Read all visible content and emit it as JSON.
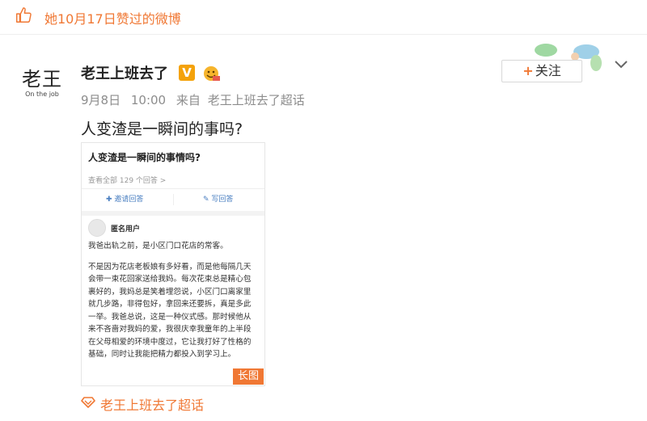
{
  "activity": {
    "text": "她10月17日赞过的微博"
  },
  "author": {
    "avatar_title": "老王",
    "avatar_subtitle": "On the job",
    "name": "老王上班去了",
    "verified_label": "V"
  },
  "post": {
    "date": "9月8日",
    "time": "10:00",
    "source_prefix": "来自",
    "source": "老王上班去了超话",
    "text": "人变渣是一瞬间的事吗?"
  },
  "follow_button": {
    "label": "关注"
  },
  "card": {
    "question_title": "人变渣是一瞬间的事情吗?",
    "view_all": "查看全部 129 个回答 >",
    "invite_label": "邀请回答",
    "write_label": "写回答",
    "anon_name": "匿名用户",
    "para1": "我爸出轨之前，是小区门口花店的常客。",
    "para2": "不是因为花店老板娘有多好看，而是他每隔几天会带一束花回家送给我妈。每次花束总是精心包裹好的，我妈总是笑着埋怨说，小区门口离家里就几步路，非得包好，拿回来还要拆，真是多此一举。我爸总说，这是一种仪式感。那时候他从来不吝啬对我妈的爱，我很庆幸我童年的上半段在父母相爱的环境中度过，它让我打好了性格的基础，同时让我能把精力都投入到学习上。",
    "long_image_tag": "长图"
  },
  "topic": {
    "label": "老王上班去了超话"
  },
  "colors": {
    "accent": "#f07834",
    "link": "#4a7fc1",
    "vbadge": "#f4a20b"
  }
}
